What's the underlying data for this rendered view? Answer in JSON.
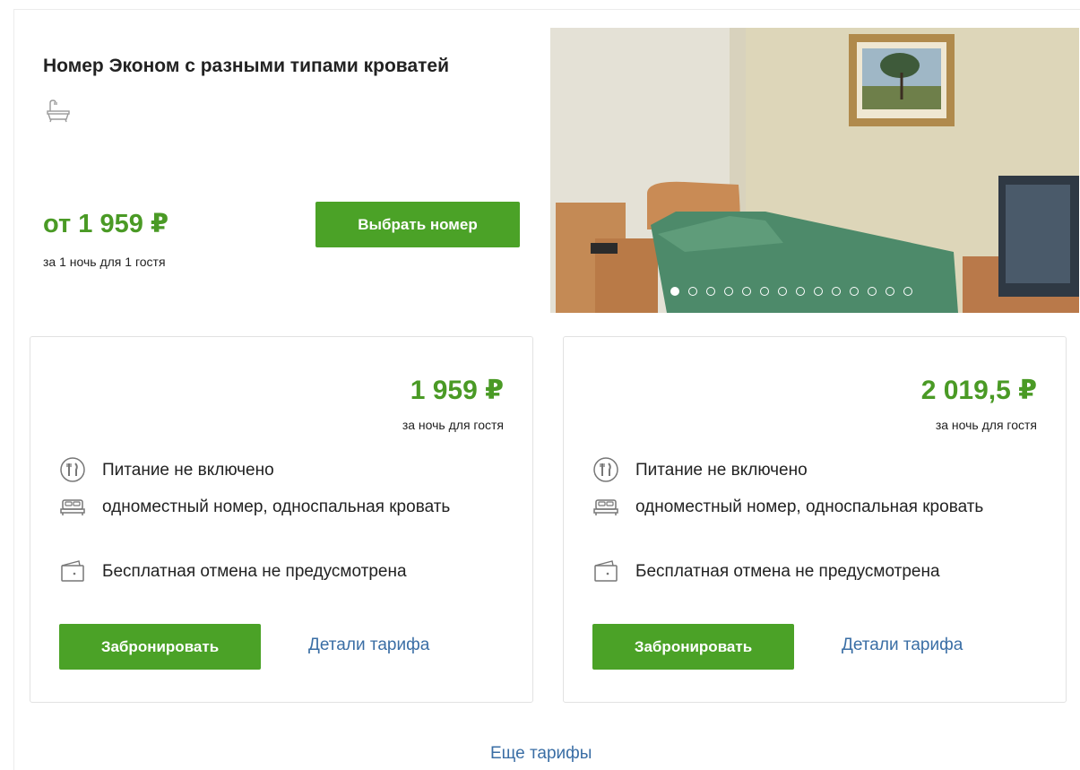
{
  "room": {
    "title": "Номер Эконом с разными типами кроватей",
    "from_price": "от 1 959 ₽",
    "from_note": "за 1 ночь для 1 гостя",
    "select_label": "Выбрать номер",
    "amenity_icon": "bathtub-icon"
  },
  "gallery": {
    "image_icon": "hotel-room-photo",
    "dot_count": 14,
    "active_index": 0
  },
  "tariffs": [
    {
      "price": "1 959 ₽",
      "note": "за ночь для гостя",
      "meal": "Питание не включено",
      "bed": "одноместный номер, односпальная кровать",
      "cancel": "Бесплатная отмена не предусмотрена",
      "book_label": "Забронировать",
      "details_label": "Детали тарифа"
    },
    {
      "price": "2 019,5 ₽",
      "note": "за ночь для гостя",
      "meal": "Питание не включено",
      "bed": "одноместный номер, односпальная кровать",
      "cancel": "Бесплатная отмена не предусмотрена",
      "book_label": "Забронировать",
      "details_label": "Детали тарифа"
    }
  ],
  "more_tariffs": "Еще тарифы",
  "colors": {
    "accent_green": "#4ba227",
    "price_green": "#4a9a25",
    "link_blue": "#3a6ea5"
  }
}
